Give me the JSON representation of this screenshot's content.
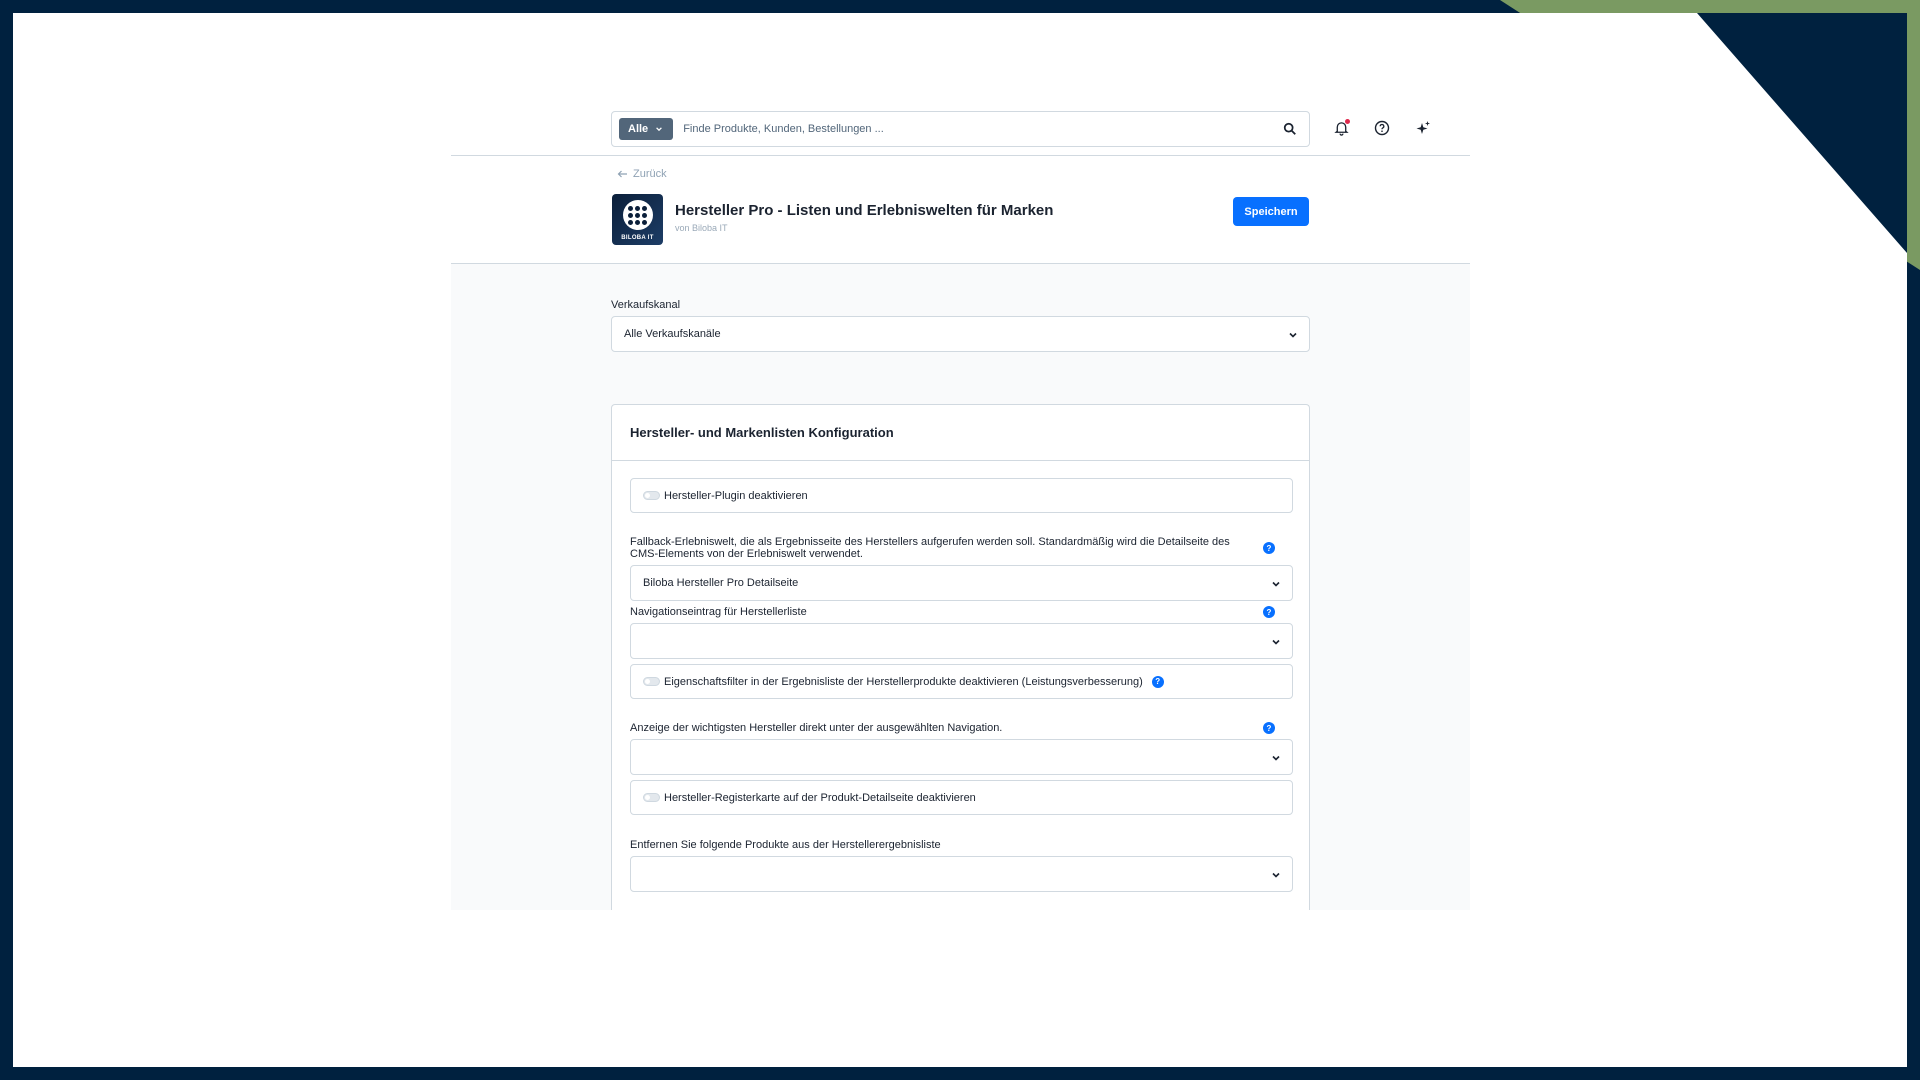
{
  "search": {
    "filter_label": "Alle",
    "placeholder": "Finde Produkte, Kunden, Bestellungen ..."
  },
  "icons": {
    "search": "search-icon",
    "notifications": "bell-icon",
    "help": "help-circle-icon",
    "ai": "sparkle-icon"
  },
  "header": {
    "back_label": "Zurück",
    "logo_text": "BILOBA IT",
    "title": "Hersteller Pro - Listen und Erlebniswelten für Marken",
    "vendor": "von Biloba IT",
    "save_label": "Speichern"
  },
  "sales_channel": {
    "label": "Verkaufskanal",
    "value": "Alle Verkaufskanäle"
  },
  "card": {
    "title": "Hersteller- und Markenlisten Konfiguration",
    "disable_plugin": {
      "label": "Hersteller-Plugin deaktivieren",
      "enabled": false
    },
    "fallback": {
      "label": "Fallback-Erlebniswelt, die als Ergebnisseite des Herstellers aufgerufen werden soll. Standardmäßig wird die Detailseite des CMS-Elements von der Erlebniswelt verwendet.",
      "value": "Biloba Hersteller Pro Detailseite"
    },
    "nav_entry": {
      "label": "Navigationseintrag für Herstellerliste",
      "value": ""
    },
    "property_filter": {
      "label": "Eigenschaftsfilter in der Ergebnisliste der Herstellerprodukte deaktivieren (Leistungsverbesserung)",
      "enabled": false
    },
    "top_manufacturers": {
      "label": "Anzeige der wichtigsten Hersteller direkt unter der ausgewählten Navigation.",
      "value": ""
    },
    "disable_tab": {
      "label": "Hersteller-Registerkarte auf der Produkt-Detailseite deaktivieren",
      "enabled": false
    },
    "exclude_products": {
      "label": "Entfernen Sie folgende Produkte aus der Herstellerergebnisliste",
      "value": ""
    },
    "help_glyph": "?"
  },
  "colors": {
    "accent": "#0870ff",
    "background": "#00213f",
    "corner": "#7a9a62"
  }
}
